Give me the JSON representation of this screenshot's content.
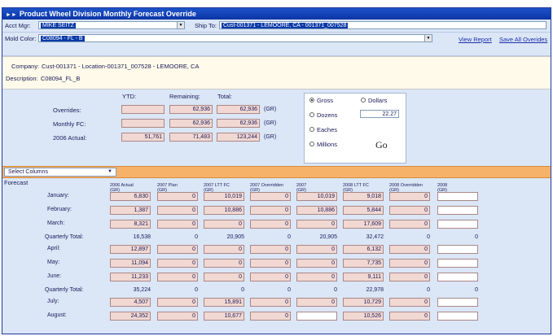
{
  "title": "Product Wheel Division Monthly Forecast Override",
  "top": {
    "acct_mgr_label": "Acct Mgr:",
    "acct_mgr_value": "MIKE SEITZ",
    "ship_to_label": "Ship To:",
    "ship_to_value": "Cust-001371 - LEMOORE, CA - 001371_007528",
    "mold_color_label": "Mold Color:",
    "mold_color_value": "C08094 - FL - B",
    "view_report": "View Report",
    "save_all": "Save All Overides"
  },
  "info": {
    "company_label": "Company:",
    "company_value": "Cust-001371 - Location-001371_007528 - LEMOORE, CA",
    "description_label": "Description:",
    "description_value": "C08094_FL_B"
  },
  "overrides": {
    "headers": [
      "YTD:",
      "Remaining:",
      "Total:"
    ],
    "rows": [
      {
        "label": "Overrides:",
        "ytd": "",
        "remaining": "62,936",
        "total": "62,936",
        "unit": "(GR)"
      },
      {
        "label": "Monthly FC:",
        "ytd": "",
        "remaining": "62,936",
        "total": "62,936",
        "unit": "(GR)"
      },
      {
        "label": "2006 Actual:",
        "ytd": "51,761",
        "remaining": "71,483",
        "total": "123,244",
        "unit": "(GR)"
      }
    ]
  },
  "units": {
    "gross": "Gross",
    "dollars": "Dollars",
    "dozens": "Dozens",
    "dollars_value": "22.27",
    "eaches": "Eaches",
    "millions": "Millions",
    "go": "Go",
    "selected": "gross"
  },
  "column_select": {
    "label": "Select Columns"
  },
  "forecast": {
    "title": "Forecast",
    "columns": [
      {
        "name": "2006 Actual",
        "unit": "(GR)"
      },
      {
        "name": "2007 Plan",
        "unit": "(GR)"
      },
      {
        "name": "2007 LTT FC",
        "unit": "(GR)"
      },
      {
        "name": "2007 Overridden",
        "unit": "(GR)"
      },
      {
        "name": "2007",
        "unit": "(GR)"
      },
      {
        "name": "2008 LTT FC",
        "unit": "(GR)"
      },
      {
        "name": "2008 Overridden",
        "unit": "(GR)"
      },
      {
        "name": "2008",
        "unit": "(GR)"
      }
    ],
    "rows": [
      {
        "label": "January:",
        "type": "month",
        "values": [
          "6,830",
          "0",
          "10,019",
          "0",
          "10,019",
          "9,018",
          "0",
          ""
        ]
      },
      {
        "label": "February:",
        "type": "month",
        "values": [
          "1,387",
          "0",
          "10,886",
          "0",
          "10,886",
          "5,844",
          "0",
          ""
        ]
      },
      {
        "label": "March:",
        "type": "month",
        "values": [
          "8,321",
          "0",
          "0",
          "0",
          "0",
          "17,609",
          "0",
          ""
        ]
      },
      {
        "label": "Quarterly Total:",
        "type": "total",
        "values": [
          "16,538",
          "0",
          "20,905",
          "0",
          "20,905",
          "32,472",
          "0",
          "0"
        ]
      },
      {
        "label": "April:",
        "type": "month",
        "values": [
          "12,897",
          "0",
          "0",
          "0",
          "0",
          "6,132",
          "0",
          ""
        ]
      },
      {
        "label": "May:",
        "type": "month",
        "values": [
          "11,094",
          "0",
          "0",
          "0",
          "0",
          "7,735",
          "0",
          ""
        ]
      },
      {
        "label": "June:",
        "type": "month",
        "values": [
          "11,233",
          "0",
          "0",
          "0",
          "0",
          "9,111",
          "0",
          ""
        ]
      },
      {
        "label": "Quarterly Total:",
        "type": "total",
        "values": [
          "35,224",
          "0",
          "0",
          "0",
          "0",
          "22,978",
          "0",
          "0"
        ]
      },
      {
        "label": "July:",
        "type": "month",
        "values": [
          "4,507",
          "0",
          "15,891",
          "0",
          "0",
          "10,729",
          "0",
          ""
        ]
      },
      {
        "label": "August:",
        "type": "month",
        "values": [
          "24,352",
          "0",
          "10,677",
          "0",
          "",
          "10,526",
          "0",
          ""
        ]
      }
    ]
  }
}
